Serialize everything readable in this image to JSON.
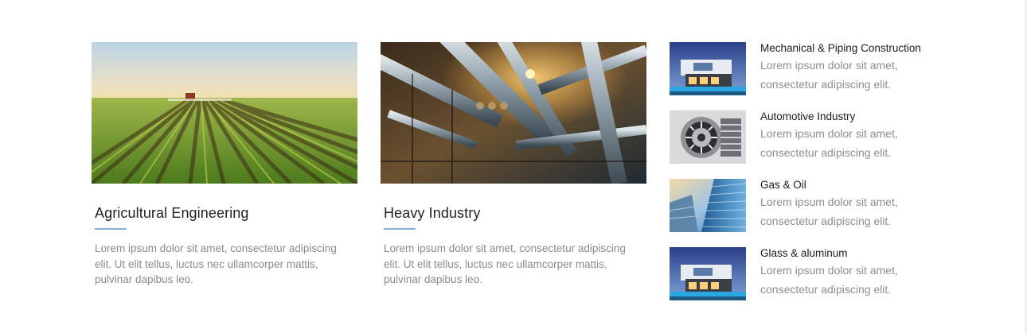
{
  "cards": [
    {
      "title": "Agricultural Engineering",
      "text": "Lorem ipsum dolor sit amet, consectetur adipiscing elit. Ut elit tellus, luctus nec ullamcorper mattis, pulvinar dapibus leo.",
      "image": "farm-field-photo"
    },
    {
      "title": "Heavy Industry",
      "text": "Lorem ipsum dolor sit amet, consectetur adipiscing elit. Ut elit tellus, luctus nec ullamcorper mattis, pulvinar dapibus leo.",
      "image": "industrial-pipes-photo"
    }
  ],
  "side_items": [
    {
      "title": "Mechanical & Piping Construction",
      "text": "Lorem ipsum dolor sit amet, consectetur adipiscing elit.",
      "image": "modern-house-photo"
    },
    {
      "title": "Automotive Industry",
      "text": "Lorem ipsum dolor sit amet, consectetur adipiscing elit.",
      "image": "alternator-photo"
    },
    {
      "title": "Gas & Oil",
      "text": "Lorem ipsum dolor sit amet, consectetur adipiscing elit.",
      "image": "glass-skyscraper-photo"
    },
    {
      "title": "Glass & aluminum",
      "text": "Lorem ipsum dolor sit amet, consectetur adipiscing elit.",
      "image": "modern-house-photo"
    }
  ],
  "colors": {
    "title": "#222222",
    "body_text": "#8b8b8b",
    "accent_underline": "#7fb0e0"
  }
}
